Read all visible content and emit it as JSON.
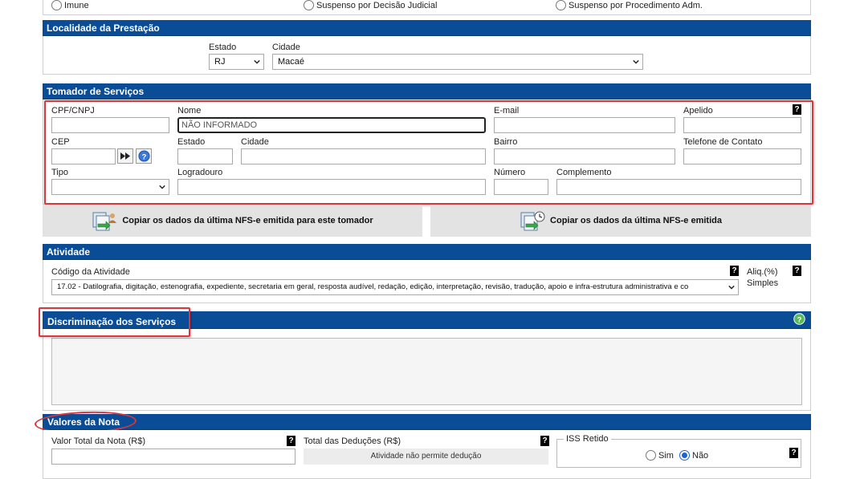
{
  "top_radios": {
    "imune": "Imune",
    "susp_judicial": "Suspenso por Decisão Judicial",
    "susp_adm": "Suspenso por Procedimento Adm."
  },
  "localidade": {
    "title": "Localidade da Prestação",
    "estado_label": "Estado",
    "estado_value": "RJ",
    "cidade_label": "Cidade",
    "cidade_value": "Macaé"
  },
  "tomador": {
    "title": "Tomador de Serviços",
    "cpf_label": "CPF/CNPJ",
    "nome_label": "Nome",
    "nome_value": "NÃO INFORMADO",
    "email_label": "E-mail",
    "apelido_label": "Apelido",
    "cep_label": "CEP",
    "estado_label": "Estado",
    "cidade_label": "Cidade",
    "bairro_label": "Bairro",
    "telefone_label": "Telefone de Contato",
    "tipo_label": "Tipo",
    "logradouro_label": "Logradouro",
    "numero_label": "Número",
    "complemento_label": "Complemento",
    "help": "?"
  },
  "copy_buttons": {
    "last_for_tomador": "Copiar os dados da última NFS-e emitida para este tomador",
    "last_emitted": "Copiar os dados da última NFS-e emitida"
  },
  "atividade": {
    "title": "Atividade",
    "codigo_label": "Código da Atividade",
    "codigo_value": "17.02 - Datilografia, digitação, estenografia, expediente, secretaria em geral, resposta audível, redação, edição, interpretação, revisão, tradução, apoio e infra-estrutura administrativa e co",
    "aliq_label": "Aliq.(%)",
    "simples_label": "Simples",
    "help": "?"
  },
  "discriminacao": {
    "title": "Discriminação dos Serviços",
    "help": "?"
  },
  "valores": {
    "title": "Valores da Nota",
    "total_label": "Valor Total da Nota (R$)",
    "deducoes_label": "Total das Deduções (R$)",
    "deducoes_note": "Atividade não permite dedução",
    "iss_label": "ISS Retido",
    "sim": "Sim",
    "nao": "Não",
    "help": "?"
  },
  "colors": {
    "header_bar": "#0a4d96",
    "highlight": "#d9363e",
    "radio_selected": "#1a66d1"
  }
}
